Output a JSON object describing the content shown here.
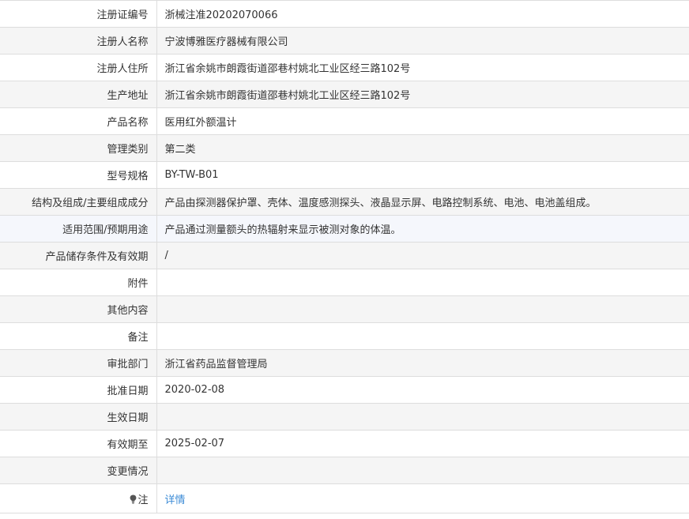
{
  "rows": [
    {
      "label": "注册证编号",
      "value": "浙械注准20202070066"
    },
    {
      "label": "注册人名称",
      "value": "宁波博雅医疗器械有限公司"
    },
    {
      "label": "注册人住所",
      "value": "浙江省余姚市朗霞街道邵巷村姚北工业区经三路102号"
    },
    {
      "label": "生产地址",
      "value": "浙江省余姚市朗霞街道邵巷村姚北工业区经三路102号"
    },
    {
      "label": "产品名称",
      "value": "医用红外额温计"
    },
    {
      "label": "管理类别",
      "value": "第二类"
    },
    {
      "label": "型号规格",
      "value": "BY-TW-B01"
    },
    {
      "label": "结构及组成/主要组成成分",
      "value": "产品由探测器保护罩、壳体、温度感测探头、液晶显示屏、电路控制系统、电池、电池盖组成。"
    },
    {
      "label": "适用范围/预期用途",
      "value": "产品通过测量额头的热辐射来显示被测对象的体温。"
    },
    {
      "label": "产品储存条件及有效期",
      "value": "/"
    },
    {
      "label": "附件",
      "value": ""
    },
    {
      "label": "其他内容",
      "value": ""
    },
    {
      "label": "备注",
      "value": ""
    },
    {
      "label": "审批部门",
      "value": "浙江省药品监督管理局"
    },
    {
      "label": "批准日期",
      "value": "2020-02-08"
    },
    {
      "label": "生效日期",
      "value": ""
    },
    {
      "label": "有效期至",
      "value": "2025-02-07"
    },
    {
      "label": "变更情况",
      "value": ""
    }
  ],
  "note": {
    "icon": "lightbulb-icon",
    "label": "注",
    "link_text": "详情"
  },
  "colors": {
    "border": "#dddddd",
    "alt_row": "#f5f5f5",
    "hover_row": "#f5f7fc",
    "link": "#3b8bd6",
    "text": "#333333"
  }
}
